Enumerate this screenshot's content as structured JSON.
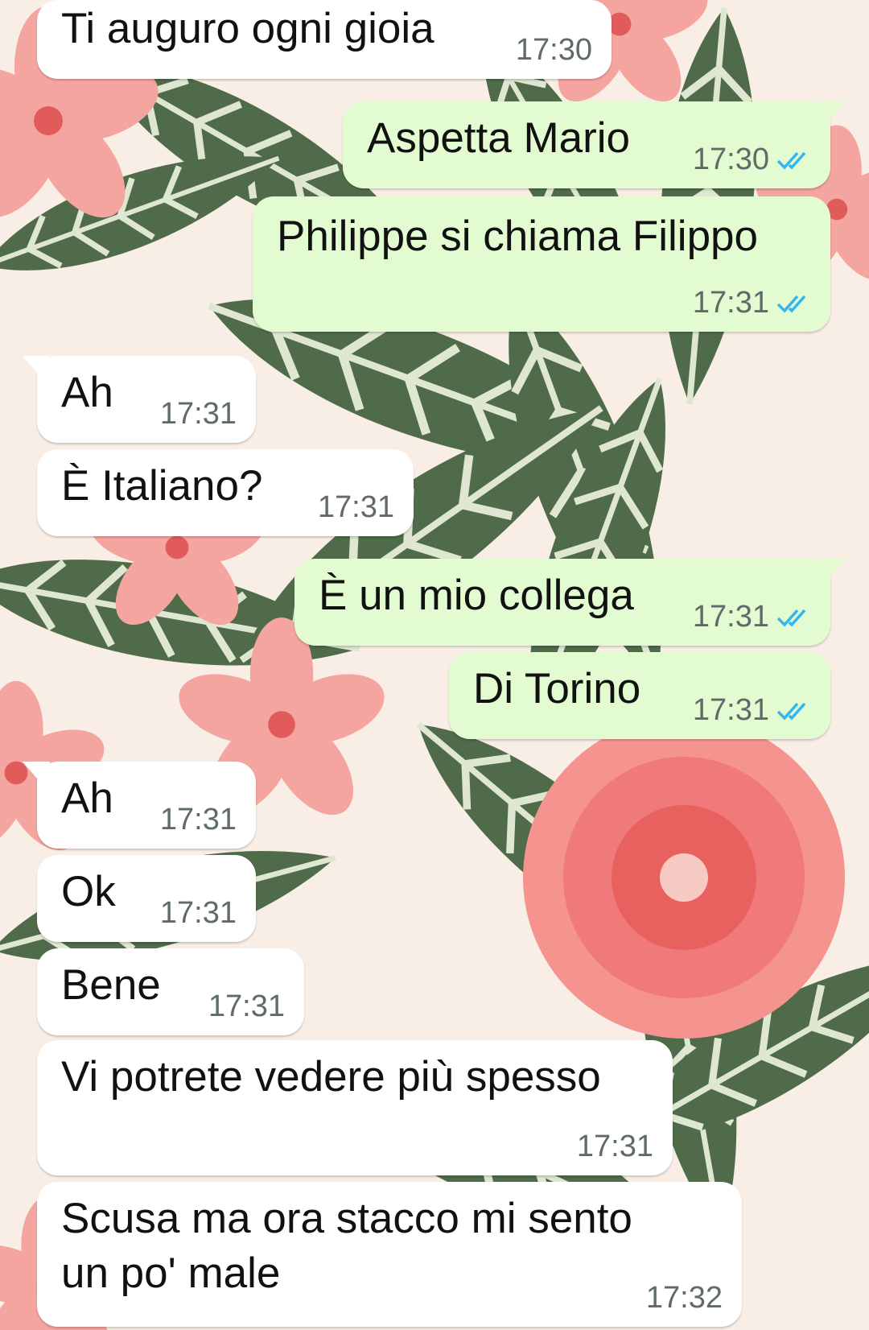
{
  "colors": {
    "incoming_bubble": "#ffffff",
    "outgoing_bubble": "#e2fbd0",
    "timestamp": "#5f6b6a",
    "read_ticks": "#34b7f1"
  },
  "icons": {
    "read_receipt": "double-check-icon"
  },
  "messages": [
    {
      "direction": "incoming",
      "text": "Ti auguro ogni gioia",
      "time": "17:30"
    },
    {
      "direction": "outgoing",
      "text": "Aspetta Mario",
      "time": "17:30",
      "status": "read"
    },
    {
      "direction": "outgoing",
      "text": "Philippe si chiama Filippo",
      "time": "17:31",
      "status": "read"
    },
    {
      "direction": "incoming",
      "text": "Ah",
      "time": "17:31"
    },
    {
      "direction": "incoming",
      "text": "È Italiano?",
      "time": "17:31"
    },
    {
      "direction": "outgoing",
      "text": "È un mio collega",
      "time": "17:31",
      "status": "read"
    },
    {
      "direction": "outgoing",
      "text": "Di Torino",
      "time": "17:31",
      "status": "read"
    },
    {
      "direction": "incoming",
      "text": "Ah",
      "time": "17:31"
    },
    {
      "direction": "incoming",
      "text": "Ok",
      "time": "17:31"
    },
    {
      "direction": "incoming",
      "text": "Bene",
      "time": "17:31"
    },
    {
      "direction": "incoming",
      "text": "Vi potrete vedere più spesso",
      "time": "17:31"
    },
    {
      "direction": "incoming",
      "text": "Scusa ma ora stacco mi sento\nun po' male",
      "time": "17:32"
    }
  ]
}
